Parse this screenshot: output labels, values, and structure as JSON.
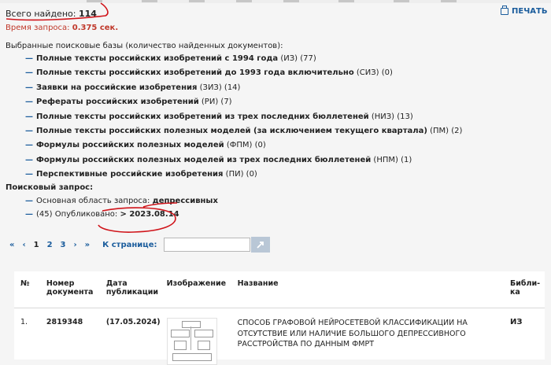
{
  "summary": {
    "total_label": "Всего найдено:",
    "total_value": "114",
    "time_label": "Время запроса:",
    "time_value": "0.375 сек."
  },
  "print": {
    "label": "ПЕЧАТЬ",
    "icon": "printer-icon"
  },
  "databases": {
    "header": "Выбранные поисковые базы (количество найденных документов):",
    "items": [
      {
        "name": "Полные тексты российских изобретений с 1994 года",
        "code": "(ИЗ)",
        "count": "(77)"
      },
      {
        "name": "Полные тексты российских изобретений до 1993 года включительно",
        "code": "(СИЗ)",
        "count": "(0)"
      },
      {
        "name": "Заявки на российские изобретения",
        "code": "(ЗИЗ)",
        "count": "(14)"
      },
      {
        "name": "Рефераты российских изобретений",
        "code": "(РИ)",
        "count": "(7)"
      },
      {
        "name": "Полные тексты российских изобретений из трех последних бюллетеней",
        "code": "(НИЗ)",
        "count": "(13)"
      },
      {
        "name": "Полные тексты российских полезных моделей (за исключением текущего квартала)",
        "code": "(ПМ)",
        "count": "(2)"
      },
      {
        "name": "Формулы российских полезных моделей",
        "code": "(ФПМ)",
        "count": "(0)"
      },
      {
        "name": "Формулы российских полезных моделей из трех последних бюллетеней",
        "code": "(НПМ)",
        "count": "(1)"
      },
      {
        "name": "Перспективные российские изобретения",
        "code": "(ПИ)",
        "count": "(0)"
      }
    ]
  },
  "query": {
    "header": "Поисковый запрос:",
    "items": [
      {
        "label": "Основная область запроса:",
        "value": "депрессивных"
      },
      {
        "label": "(45) Опубликовано:",
        "value": "> 2023.08.14"
      }
    ]
  },
  "pager": {
    "first": "«",
    "prev": "‹",
    "pages": [
      "1",
      "2",
      "3"
    ],
    "current": "1",
    "next": "›",
    "last": "»",
    "goto_label": "К странице:",
    "input_value": ""
  },
  "table": {
    "headers": {
      "no": "№",
      "number": "Номер документа",
      "date": "Дата публикации",
      "image": "Изображение",
      "name": "Название",
      "base": "Библи-ка"
    },
    "rows": [
      {
        "no": "1.",
        "number": "2819348",
        "date": "(17.05.2024)",
        "title": "СПОСОБ ГРАФОВОЙ НЕЙРОСЕТЕВОЙ КЛАССИФИКАЦИИ НА ОТСУТСТВИЕ ИЛИ НАЛИЧИЕ БОЛЬШОГО ДЕПРЕССИВНОГО РАССТРОЙСТВА ПО ДАННЫМ ФМРТ",
        "base": "ИЗ"
      }
    ]
  },
  "colors": {
    "accent": "#1a5c9c",
    "time_red": "#c0392b",
    "annotation_red": "#d0141a"
  }
}
